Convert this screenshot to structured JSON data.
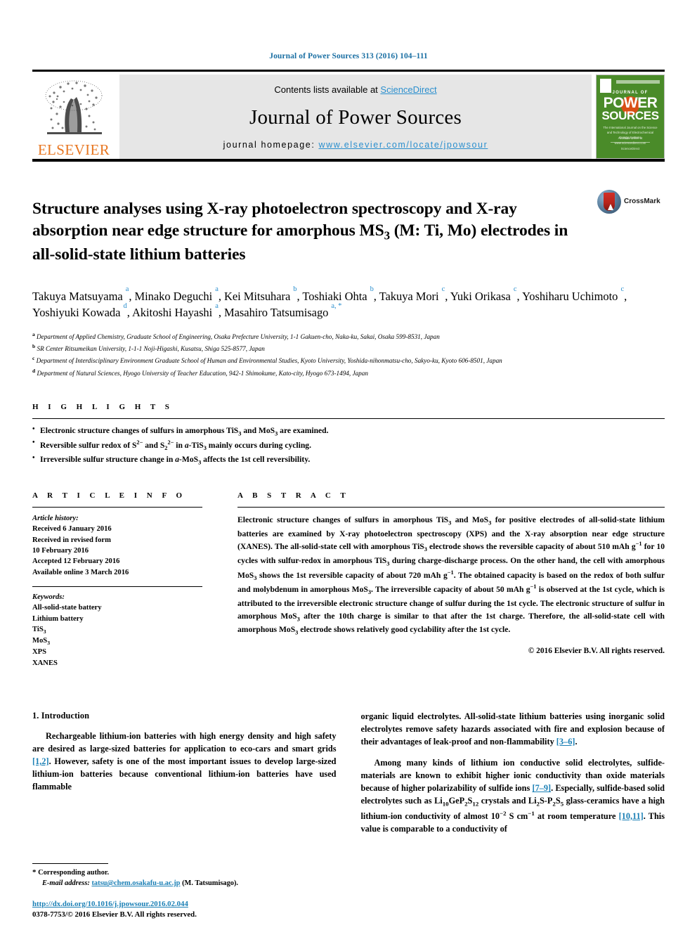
{
  "running_head": "Journal of Power Sources 313 (2016) 104–111",
  "masthead": {
    "contents_prefix": "Contents lists available at ",
    "sciencedirect": "ScienceDirect",
    "journal_title": "Journal of Power Sources",
    "homepage_prefix": "journal homepage: ",
    "homepage_url": "www.elsevier.com/locate/jpowsour",
    "publisher_wordmark": "ELSEVIER",
    "cover": {
      "line_journal_of": "JOURNAL OF",
      "line_power": "POWER",
      "line_sources": "SOURCES",
      "subtitle": "The International Journal on the Science and Technology of Electrochemical Energy Systems",
      "footer": "Available online at www.sciencedirect.com ScienceDirect"
    },
    "colors": {
      "link": "#2b8fce",
      "cover_green": "#4a8b29",
      "cover_orange": "#d94f16",
      "elsevier_orange": "#E87722"
    }
  },
  "crossmark": {
    "label": "CrossMark"
  },
  "title": "Structure analyses using X-ray photoelectron spectroscopy and X-ray absorption near edge structure for amorphous MS₃ (M: Ti, Mo) electrodes in all-solid-state lithium batteries",
  "authors": [
    {
      "name": "Takuya Matsuyama",
      "marks": "a",
      "sep": ", "
    },
    {
      "name": "Minako Deguchi",
      "marks": "a",
      "sep": ", "
    },
    {
      "name": "Kei Mitsuhara",
      "marks": "b",
      "sep": ", "
    },
    {
      "name": "Toshiaki Ohta",
      "marks": "b",
      "sep": ", "
    },
    {
      "name": "Takuya Mori",
      "marks": "c",
      "sep": ", "
    },
    {
      "name": "Yuki Orikasa",
      "marks": "c",
      "sep": ", "
    },
    {
      "name": "Yoshiharu Uchimoto",
      "marks": "c",
      "sep": ", "
    },
    {
      "name": "Yoshiyuki Kowada",
      "marks": "d",
      "sep": ", "
    },
    {
      "name": "Akitoshi Hayashi",
      "marks": "a",
      "sep": ", "
    },
    {
      "name": "Masahiro Tatsumisago",
      "marks": "a, *",
      "sep": ""
    }
  ],
  "affiliations": [
    {
      "mark": "a",
      "text": "Department of Applied Chemistry, Graduate School of Engineering, Osaka Prefecture University, 1-1 Gakuen-cho, Naka-ku, Sakai, Osaka 599-8531, Japan"
    },
    {
      "mark": "b",
      "text": "SR Center Ritsumeikan University, 1-1-1 Noji-Higashi, Kusatsu, Shiga 525-8577, Japan"
    },
    {
      "mark": "c",
      "text": "Department of Interdisciplinary Environment Graduate School of Human and Environmental Studies, Kyoto University, Yoshida-nihonmatsu-cho, Sakyo-ku, Kyoto 606-8501, Japan"
    },
    {
      "mark": "d",
      "text": "Department of Natural Sciences, Hyogo University of Teacher Education, 942-1 Shimokume, Kato-city, Hyogo 673-1494, Japan"
    }
  ],
  "highlights": {
    "label": "H I G H L I G H T S",
    "items": [
      "Electronic structure changes of sulfurs in amorphous TiS₃ and MoS₃ are examined.",
      "Reversible sulfur redox of S²⁻ and S₂²⁻ in a-TiS₃ mainly occurs during cycling.",
      "Irreversible sulfur structure change in a-MoS₃ affects the 1st cell reversibility."
    ]
  },
  "article_info": {
    "label": "A R T I C L E   I N F O",
    "history_label": "Article history:",
    "history": [
      "Received 6 January 2016",
      "Received in revised form",
      "10 February 2016",
      "Accepted 12 February 2016",
      "Available online 3 March 2016"
    ],
    "keywords_label": "Keywords:",
    "keywords": [
      "All-solid-state battery",
      "Lithium battery",
      "TiS₃",
      "MoS₃",
      "XPS",
      "XANES"
    ]
  },
  "abstract": {
    "label": "A B S T R A C T",
    "text": "Electronic structure changes of sulfurs in amorphous TiS₃ and MoS₃ for positive electrodes of all-solid-state lithium batteries are examined by X-ray photoelectron spectroscopy (XPS) and the X-ray absorption near edge structure (XANES). The all-solid-state cell with amorphous TiS₃ electrode shows the reversible capacity of about 510 mAh g⁻¹ for 10 cycles with sulfur-redox in amorphous TiS₃ during charge-discharge process. On the other hand, the cell with amorphous MoS₃ shows the 1st reversible capacity of about 720 mAh g⁻¹. The obtained capacity is based on the redox of both sulfur and molybdenum in amorphous MoS₃. The irreversible capacity of about 50 mAh g⁻¹ is observed at the 1st cycle, which is attributed to the irreversible electronic structure change of sulfur during the 1st cycle. The electronic structure of sulfur in amorphous MoS₃ after the 10th charge is similar to that after the 1st charge. Therefore, the all-solid-state cell with amorphous MoS₃ electrode shows relatively good cyclability after the 1st cycle.",
    "copyright": "© 2016 Elsevier B.V. All rights reserved."
  },
  "body": {
    "section_heading": "1. Introduction",
    "left_paragraph": "Rechargeable lithium-ion batteries with high energy density and high safety are desired as large-sized batteries for application to eco-cars and smart grids [1,2]. However, safety is one of the most important issues to develop large-sized lithium-ion batteries because conventional lithium-ion batteries have used flammable",
    "right_paragraph_1": "organic liquid electrolytes. All-solid-state lithium batteries using inorganic solid electrolytes remove safety hazards associated with fire and explosion because of their advantages of leak-proof and non-flammability [3–6].",
    "right_paragraph_2": "Among many kinds of lithium ion conductive solid electrolytes, sulfide-materials are known to exhibit higher ionic conductivity than oxide materials because of higher polarizability of sulfide ions [7–9]. Especially, sulfide-based solid electrolytes such as Li₁₀GeP₂S₁₂ crystals and Li₂S-P₂S₅ glass-ceramics have a high lithium-ion conductivity of almost 10⁻² S cm⁻¹ at room temperature [10,11]. This value is comparable to a conductivity of",
    "citations": [
      "[1,2]",
      "[3–6]",
      "[7–9]",
      "[10,11]"
    ]
  },
  "footnote": {
    "corresponding_star": "*",
    "corresponding_label": "Corresponding author.",
    "email_label": "E-mail address:",
    "email": "tatsu@chem.osakafu-u.ac.jp",
    "email_who": "(M. Tatsumisago)."
  },
  "footer": {
    "doi": "http://dx.doi.org/10.1016/j.jpowsour.2016.02.044",
    "issn_line": "0378-7753/© 2016 Elsevier B.V. All rights reserved."
  }
}
